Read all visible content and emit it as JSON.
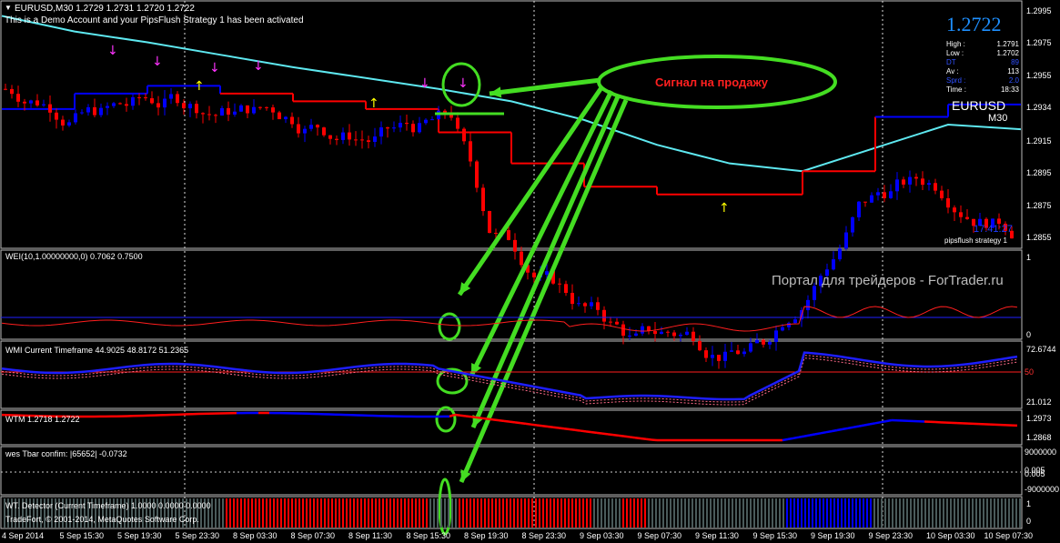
{
  "header": {
    "menu_icon": "triangle-down-icon",
    "symbol_line": "EURUSD,M30  1.2729 1.2731 1.2720 1.2722",
    "notice": "This is a Demo Account and your PipsFlush Strategy 1 has been activated"
  },
  "price_panel": {
    "big_price": "1.2722",
    "stats": [
      {
        "key": "High :",
        "value": "1.2791"
      },
      {
        "key": "Low :",
        "value": "1.2702"
      },
      {
        "key": "DT",
        "value": "89"
      },
      {
        "key": "Av :",
        "value": "113"
      },
      {
        "key": "Sprd :",
        "value": "2.0"
      },
      {
        "key": "Time :",
        "value": "18:33"
      }
    ],
    "symbol": "EURUSD",
    "timeframe": "M30",
    "clock": "17:41:27",
    "strategy": "pipsflush strategy 1",
    "sell_signal": "Сигнал на продажу",
    "price_axis": [
      "1.2995",
      "1.2975",
      "1.2955",
      "1.2934",
      "1.2915",
      "1.2895",
      "1.2875",
      "1.2855"
    ]
  },
  "watermark": "Портал для трейдеров - ForTrader.ru",
  "indicators": {
    "wei": {
      "title": "WEI(10,1.00000000,0) 0.7062 0.7500",
      "axis": [
        "1",
        "0"
      ]
    },
    "wmi": {
      "title": "WMI Current Timeframe 44.9025 48.8172 51.2365",
      "axis": [
        "72.6744",
        "50",
        "21.012"
      ]
    },
    "wtm": {
      "title": "WTM 1.2718 1.2722",
      "axis": [
        "1.2973",
        "1.2868"
      ]
    },
    "wes": {
      "title": "wes Tbar confim: |65652|  -0.0732",
      "axis": [
        "9000000",
        "0.005",
        "0.005",
        "-9000000"
      ]
    },
    "wt": {
      "title": "WT. Detector (Current Timeframe) 1.0000 0.0000 0.0000",
      "copyright": "TradeFort, © 2001-2014, MetaQuotes Software Corp.",
      "axis": [
        "1",
        "0"
      ]
    }
  },
  "time_axis": [
    "4 Sep 2014",
    "5 Sep 15:30",
    "5 Sep 19:30",
    "5 Sep 23:30",
    "8 Sep 03:30",
    "8 Sep 07:30",
    "8 Sep 11:30",
    "8 Sep 15:30",
    "8 Sep 19:30",
    "8 Sep 23:30",
    "9 Sep 03:30",
    "9 Sep 07:30",
    "9 Sep 11:30",
    "9 Sep 15:30",
    "9 Sep 19:30",
    "9 Sep 23:30",
    "10 Sep 03:30",
    "10 Sep 07:30"
  ],
  "colors": {
    "bull": "#0000ff",
    "bear": "#ff0000",
    "signal_green": "#44dd22",
    "ma_cyan": "#5ee8f0",
    "arrow_magenta": "#ff33ff",
    "arrow_yellow": "#ffff00",
    "label_red": "#ff2020"
  },
  "chart_data": {
    "type": "candlestick",
    "ma_cyan_values": [
      1.2995,
      1.2985,
      1.2978,
      1.297,
      1.2962,
      1.2955,
      1.2948,
      1.294,
      1.2928,
      1.2912,
      1.29,
      1.2895,
      1.291,
      1.2925,
      1.2922
    ],
    "stop_line_values": [
      1.2935,
      1.2945,
      1.295,
      1.2945,
      1.294,
      1.2935,
      1.292,
      1.29,
      1.2885,
      1.288,
      1.288,
      1.2895,
      1.293,
      1.2938
    ],
    "price_ylim": [
      1.285,
      1.3
    ]
  }
}
